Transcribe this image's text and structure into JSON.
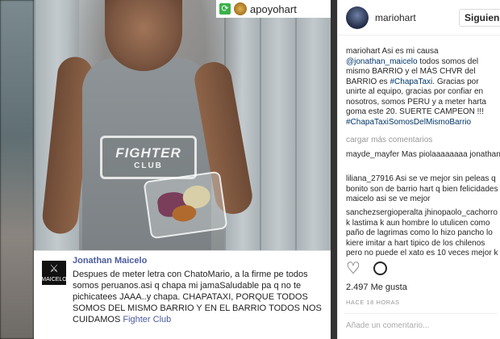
{
  "repost": {
    "icon": "repost-icon",
    "username": "apoyohart"
  },
  "embedded_post": {
    "shirt_logo_line1": "FIGHTER",
    "shirt_logo_line2": "CLUB",
    "logo_text": "MAICELO",
    "author": "Jonathan Maicelo",
    "text": "Despues de meter letra con ChatoMario, a la firme pe todos somos peruanos.asi q chapa mi jamaSaludable pa q no te pichicatees JAAA..y chapa. CHAPATAXI, PORQUE TODOS SOMOS DEL MISMO BARRIO Y EN EL BARRIO TODOS NOS CUIDAMOS",
    "tag": "Fighter Club"
  },
  "header": {
    "username": "mariohart",
    "follow_label": "Siguiendo"
  },
  "caption": {
    "username": "mariohart",
    "text_1": "Asi es mi causa",
    "mention": "@jonathan_maicelo",
    "text_2": "todos somos del mismo BARRIO y el MÁS CHVR del BARRIO es",
    "hashtag_1": "#ChapaTaxi",
    "text_3": ". Gracias por unirte al equipo, gracias por confiar en nosotros, somos PERU y a meter harta goma este 20. SUERTE CAMPEON !!!",
    "hashtag_2": "#ChapaTaxiSomosDelMismoBarrio"
  },
  "load_more": "cargar más comentarios",
  "comments": [
    {
      "username": "mayde_mayfer",
      "text": "Mas piolaaaaaaaa jonathan"
    },
    {
      "username": "liliana_27916",
      "text": "Asi se ve mejor sin peleas q bonito son de barrio hart q bien felicidades maicelo asi se ve mejor"
    },
    {
      "username": "sanchezsergioperalta",
      "text": "jhinopaolo_cachorro k lastima k aun hombre lo utulicen como paño de lagrimas como lo hizo pancho lo kiere imitar a hart tipico de los chilenos pero no puede el xato es 10 veces mejor k"
    }
  ],
  "actions": {
    "like_icon": "heart-icon",
    "comment_icon": "comment-bubble-icon"
  },
  "likes": "2.497 Me gusta",
  "time_ago": "HACE 18 HORAS",
  "add_comment_placeholder": "Añade un comentario..."
}
